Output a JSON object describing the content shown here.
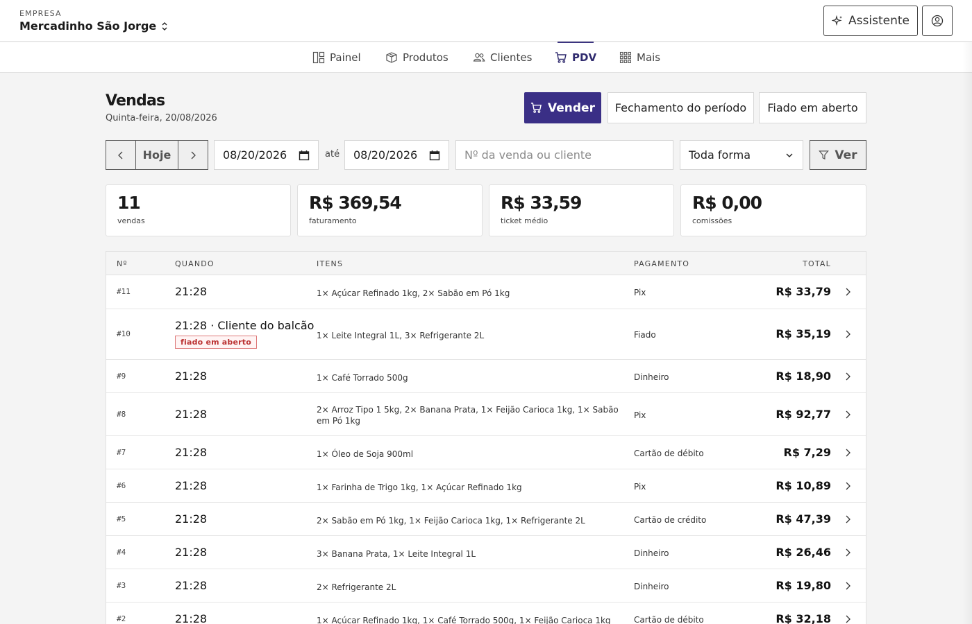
{
  "company": {
    "label": "EMPRESA",
    "name": "Mercadinho São Jorge"
  },
  "header": {
    "assistant_label": "Assistente"
  },
  "nav": [
    {
      "label": "Painel",
      "icon": "layout-icon"
    },
    {
      "label": "Produtos",
      "icon": "box-icon"
    },
    {
      "label": "Clientes",
      "icon": "users-icon"
    },
    {
      "label": "PDV",
      "icon": "cart-icon",
      "active": true
    },
    {
      "label": "Mais",
      "icon": "grid-icon"
    }
  ],
  "page": {
    "title": "Vendas",
    "date": "Quinta-feira, 20/08/2026"
  },
  "actions": {
    "sell": "Vender",
    "closing": "Fechamento do período",
    "credit": "Fiado em aberto"
  },
  "filters": {
    "today": "Hoje",
    "date_from": "08/20/2026",
    "until": "até",
    "date_to": "08/20/2026",
    "search_placeholder": "Nº da venda ou cliente",
    "payment_select": "Toda forma",
    "apply": "Ver"
  },
  "stats": [
    {
      "value": "11",
      "label": "vendas"
    },
    {
      "value": "R$ 369,54",
      "label": "faturamento"
    },
    {
      "value": "R$ 33,59",
      "label": "ticket médio"
    },
    {
      "value": "R$ 0,00",
      "label": "comissões"
    }
  ],
  "table": {
    "headers": {
      "num": "Nº",
      "when": "QUANDO",
      "items": "ITENS",
      "payment": "PAGAMENTO",
      "total": "TOTAL"
    },
    "rows": [
      {
        "num": "#11",
        "when": "21:28",
        "items": "1× Açúcar Refinado 1kg, 2× Sabão em Pó 1kg",
        "payment": "Pix",
        "total": "R$ 33,79"
      },
      {
        "num": "#10",
        "when": "21:28 · Cliente do balcão",
        "badge": "fiado em aberto",
        "items": "1× Leite Integral 1L, 3× Refrigerante 2L",
        "payment": "Fiado",
        "total": "R$ 35,19"
      },
      {
        "num": "#9",
        "when": "21:28",
        "items": "1× Café Torrado 500g",
        "payment": "Dinheiro",
        "total": "R$ 18,90"
      },
      {
        "num": "#8",
        "when": "21:28",
        "items": "2× Arroz Tipo 1 5kg, 2× Banana Prata, 1× Feijão Carioca 1kg, 1× Sabão em Pó 1kg",
        "payment": "Pix",
        "total": "R$ 92,77"
      },
      {
        "num": "#7",
        "when": "21:28",
        "items": "1× Óleo de Soja 900ml",
        "payment": "Cartão de débito",
        "total": "R$ 7,29"
      },
      {
        "num": "#6",
        "when": "21:28",
        "items": "1× Farinha de Trigo 1kg, 1× Açúcar Refinado 1kg",
        "payment": "Pix",
        "total": "R$ 10,89"
      },
      {
        "num": "#5",
        "when": "21:28",
        "items": "2× Sabão em Pó 1kg, 1× Feijão Carioca 1kg, 1× Refrigerante 2L",
        "payment": "Cartão de crédito",
        "total": "R$ 47,39"
      },
      {
        "num": "#4",
        "when": "21:28",
        "items": "3× Banana Prata, 1× Leite Integral 1L",
        "payment": "Dinheiro",
        "total": "R$ 26,46"
      },
      {
        "num": "#3",
        "when": "21:28",
        "items": "2× Refrigerante 2L",
        "payment": "Dinheiro",
        "total": "R$ 19,80"
      },
      {
        "num": "#2",
        "when": "21:28",
        "items": "1× Açúcar Refinado 1kg, 1× Café Torrado 500g, 1× Feijão Carioca 1kg",
        "payment": "Cartão de débito",
        "total": "R$ 32,18"
      }
    ]
  }
}
